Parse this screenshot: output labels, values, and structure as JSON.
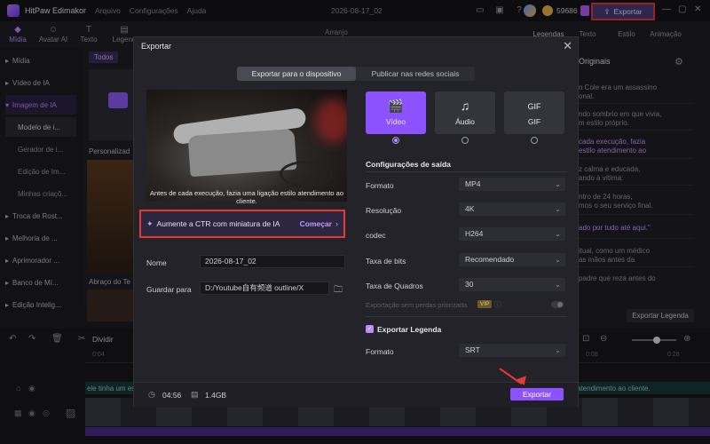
{
  "titlebar": {
    "app_name": "HitPaw Edimakor",
    "menus": [
      "Arquivo",
      "Configurações",
      "Ajuda"
    ],
    "doc_title": "2026-08-17_02",
    "coins": "59686",
    "export_label": "Exportar"
  },
  "left_tabs": [
    {
      "label": "Mídia",
      "icon": "media-icon"
    },
    {
      "label": "Avatar AI",
      "icon": "avatar-icon"
    },
    {
      "label": "Texto",
      "icon": "text-icon"
    },
    {
      "label": "Legend",
      "icon": "caption-icon"
    }
  ],
  "sidebar": {
    "items": [
      {
        "label": "Mídia",
        "type": "group"
      },
      {
        "label": "Vídeo de IA",
        "type": "group"
      },
      {
        "label": "Imagem de IA",
        "type": "active"
      },
      {
        "label": "Modelo de i...",
        "type": "subactive"
      },
      {
        "label": "Gerador de i...",
        "type": "sub"
      },
      {
        "label": "Edição de Im...",
        "type": "sub"
      },
      {
        "label": "Minhas criaçõ...",
        "type": "sub"
      },
      {
        "label": "Troca de Rost...",
        "type": "group"
      },
      {
        "label": "Melhoria de ...",
        "type": "group"
      },
      {
        "label": "Aprimorador ...",
        "type": "group"
      },
      {
        "label": "Banco de Mí...",
        "type": "group"
      },
      {
        "label": "Edição Intelig...",
        "type": "group"
      }
    ]
  },
  "media": {
    "filter": "Todos",
    "thumb1_label": "Personalizad",
    "thumb2_label": "Abraço do Te"
  },
  "preview_header": "Arranjo",
  "right_panel": {
    "tabs": [
      "Legendas",
      "Texto",
      "Estilo",
      "Animação"
    ],
    "title": "Originais",
    "lines": [
      {
        "text": "n Cole era um assassino",
        "hl": false
      },
      {
        "text": "onal.",
        "hl": false
      },
      {
        "text": "ndo sombrio em que vivia,",
        "hl": false
      },
      {
        "text": "m estilo próprio.",
        "hl": false
      },
      {
        "text": "cada execução, fazia",
        "hl": true
      },
      {
        "text": "estilo atendimento ao",
        "hl": true
      },
      {
        "text": "z calma e educada,",
        "hl": false
      },
      {
        "text": "ando à vítima:",
        "hl": false
      },
      {
        "text": "ntro de 24 horas,",
        "hl": false
      },
      {
        "text": "mos o seu serviço final.",
        "hl": false
      },
      {
        "text": "ado por tudo até aqui.\"",
        "hl": false
      },
      {
        "text": "itual, como um médico",
        "hl": false
      },
      {
        "text": "as mãos antes da",
        "hl": false
      },
      {
        "text": "padre que reza antes do",
        "hl": false
      }
    ],
    "export_legend_btn": "Exportar Legenda"
  },
  "timeline": {
    "split_label": "Dividir",
    "ruler": [
      "0:04",
      "0:08",
      "0:28"
    ],
    "subtitle_left": "ele tinha um es",
    "subtitle_right": "atendimento ao cliente."
  },
  "modal": {
    "title": "Exportar",
    "tabs": [
      {
        "label": "Exportar para o dispositivo",
        "active": true
      },
      {
        "label": "Publicar nas redes sociais",
        "active": false
      }
    ],
    "preview_caption": "Antes de cada execução, fazia uma ligação estilo atendimento ao cliente.",
    "ai_banner": {
      "text": "Aumente a CTR com miniatura de IA",
      "cta": "Começar"
    },
    "name_label": "Nome",
    "name_value": "2026-08-17_02",
    "save_label": "Guardar para",
    "save_value": "D:/Youtube自有频道 outline/X",
    "types": [
      {
        "label": "Vídeo",
        "icon": "video-icon",
        "glyph": "🎬",
        "active": true
      },
      {
        "label": "Áudio",
        "icon": "music-note-icon",
        "glyph": "♫",
        "active": false
      },
      {
        "label": "GIF",
        "icon": "gif-icon",
        "glyph": "GIF",
        "active": false
      }
    ],
    "output_section": "Configurações de saída",
    "settings": [
      {
        "label": "Formato",
        "value": "MP4"
      },
      {
        "label": "Resolução",
        "value": "4K"
      },
      {
        "label": "codec",
        "value": "H264"
      },
      {
        "label": "Taxa de bits",
        "value": "Recomendado"
      },
      {
        "label": "Taxa de Quadros",
        "value": "30"
      }
    ],
    "priority_label": "Exportação sem perdas priorizada",
    "vip_badge": "VIP",
    "export_legend_label": "Exportar Legenda",
    "legend_format_label": "Formato",
    "legend_format_value": "SRT",
    "duration": "04:56",
    "size": "1.4GB",
    "export_button": "Exportar"
  },
  "colors": {
    "accent": "#8c52ff",
    "highlight_box": "#e53935"
  }
}
